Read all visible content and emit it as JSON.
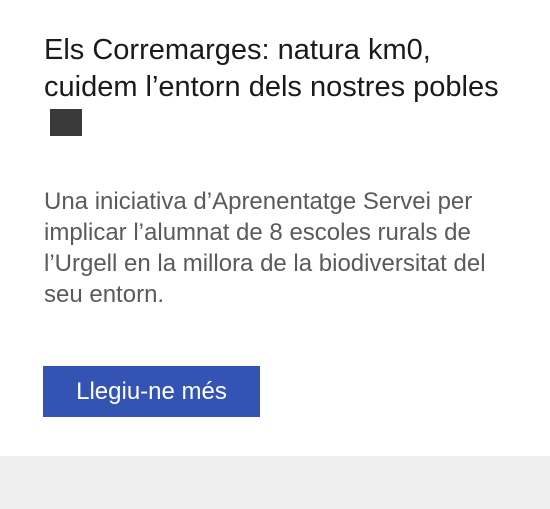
{
  "card": {
    "title": "Els Corremarges: natura km0, cuidem l’entorn dels nostres pobles",
    "description": "Una iniciativa d’Aprenentatge Servei per implicar l’alumnat de 8 escoles rurals de l’Urgell en la millora de la biodiversitat del seu entorn.",
    "read_more_label": "Llegiu-ne més"
  },
  "colors": {
    "button_background": "#3454b4",
    "button_text": "#ffffff",
    "title_text": "#1a1a1a",
    "description_text": "#5a5a5a",
    "page_background": "#f2f2f2"
  }
}
